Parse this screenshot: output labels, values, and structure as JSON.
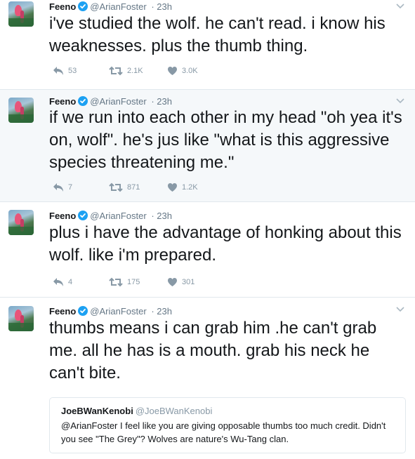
{
  "tweets": [
    {
      "name": "Feeno",
      "handle": "@ArianFoster",
      "time": "· 23h",
      "text": "i've studied the wolf. he can't read. i know his weaknesses. plus the thumb thing.",
      "replies": "53",
      "retweets": "2.1K",
      "likes": "3.0K"
    },
    {
      "name": "Feeno",
      "handle": "@ArianFoster",
      "time": "· 23h",
      "text": "if we run into each other in my head \"oh yea it's on, wolf\". he's jus like \"what is this aggressive species threatening me.\"",
      "replies": "7",
      "retweets": "871",
      "likes": "1.2K"
    },
    {
      "name": "Feeno",
      "handle": "@ArianFoster",
      "time": "· 23h",
      "text": "plus i have the advantage of honking about this wolf. like i'm prepared.",
      "replies": "4",
      "retweets": "175",
      "likes": "301"
    },
    {
      "name": "Feeno",
      "handle": "@ArianFoster",
      "time": "· 23h",
      "text": "thumbs means i can grab him .he can't grab me. all he has is a mouth. grab his neck he can't bite.",
      "quote": {
        "name": "JoeBWanKenobi",
        "handle": "@JoeBWanKenobi",
        "text": "@ArianFoster I feel like you are giving opposable thumbs too much credit. Didn't you see \"The Grey\"? Wolves are nature's Wu-Tang clan."
      }
    }
  ],
  "icons": {
    "verified": "verified-badge-icon",
    "reply": "reply-icon",
    "retweet": "retweet-icon",
    "like": "heart-icon",
    "more": "chevron-down-icon"
  },
  "colors": {
    "accent": "#1da1f2",
    "muted": "#8899a6",
    "highlight_bg": "#f5f8fa"
  }
}
